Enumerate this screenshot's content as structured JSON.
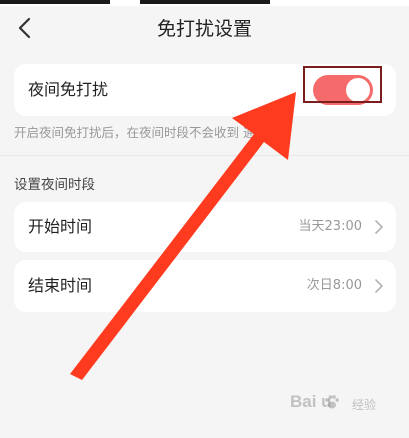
{
  "nav": {
    "title": "免打扰设置"
  },
  "night_dnd": {
    "label": "夜间免打扰",
    "toggle_on": true,
    "hint": "开启夜间免打扰后，在夜间时段不会收到    通知"
  },
  "section": {
    "title": "设置夜间时段"
  },
  "start_time": {
    "label": "开始时间",
    "value": "当天23:00"
  },
  "end_time": {
    "label": "结束时间",
    "value": "次日8:00"
  },
  "watermark": {
    "brand": "Bai  u",
    "sub": "经验"
  },
  "colors": {
    "toggle_on": "#f56a6a",
    "highlight_box": "#7a1d1d",
    "arrow": "#ff3b1f",
    "background": "#f5f5f5",
    "card": "#ffffff"
  }
}
